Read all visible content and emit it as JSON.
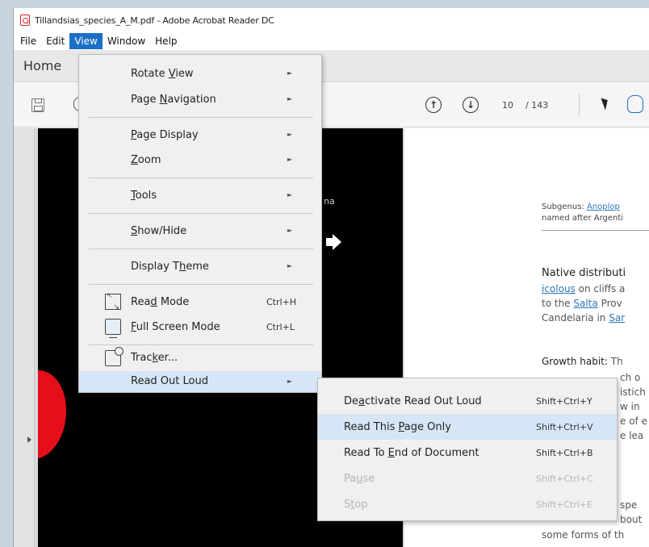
{
  "window": {
    "title": "Tillandsias_species_A_M.pdf - Adobe Acrobat Reader DC"
  },
  "menubar": {
    "items": [
      "File",
      "Edit",
      "View",
      "Window",
      "Help"
    ],
    "active": "View"
  },
  "tabbar": {
    "home_label": "Home"
  },
  "toolbar": {
    "page_current": "10",
    "page_total": "/ 143"
  },
  "page": {
    "left_fragment": "na",
    "right": {
      "subgenus_prefix": "Subgenus: ",
      "subgenus_link": "Anoplop",
      "named_after": "named after Argenti",
      "native_heading": "Native distributi",
      "line1_link": "icolous",
      "line1_rest": " on cliffs a",
      "line2_pre": "to the ",
      "line2_link": "Salta",
      "line2_rest": " Prov",
      "line3_pre": "Candelaria in ",
      "line3_link": "Sar",
      "growth_label": "Growth habit:",
      "growth_rest": " Th",
      "frag1": "ch o",
      "frag2": "istich",
      "frag3": "w in",
      "frag4": "e of e",
      "frag5": "e lea",
      "frag6": "spe",
      "frag7": "bout",
      "last_line": "some forms of th"
    }
  },
  "view_menu": {
    "items": [
      {
        "label": "Rotate View",
        "has_submenu": true
      },
      {
        "label": "Page Navigation",
        "has_submenu": true
      },
      {
        "label": "Page Display",
        "has_submenu": true
      },
      {
        "label": "Zoom",
        "has_submenu": true
      },
      {
        "label": "Tools",
        "has_submenu": true
      },
      {
        "label": "Show/Hide",
        "has_submenu": true
      },
      {
        "label": "Display Theme",
        "has_submenu": true
      },
      {
        "label": "Read Mode",
        "shortcut": "Ctrl+H",
        "icon": "read-mode-icon"
      },
      {
        "label": "Full Screen Mode",
        "shortcut": "Ctrl+L",
        "icon": "full-screen-icon"
      },
      {
        "label": "Tracker...",
        "icon": "tracker-icon"
      },
      {
        "label": "Read Out Loud",
        "has_submenu": true,
        "highlighted": true
      }
    ],
    "arrow_glyph": "►"
  },
  "read_out_loud_menu": {
    "items": [
      {
        "label": "Deactivate Read Out Loud",
        "shortcut": "Shift+Ctrl+Y",
        "enabled": true
      },
      {
        "label": "Read This Page Only",
        "shortcut": "Shift+Ctrl+V",
        "enabled": true,
        "highlighted": true
      },
      {
        "label": "Read To End of Document",
        "shortcut": "Shift+Ctrl+B",
        "enabled": true
      },
      {
        "label": "Pause",
        "shortcut": "Shift+Ctrl+C",
        "enabled": false
      },
      {
        "label": "Stop",
        "shortcut": "Shift+Ctrl+E",
        "enabled": false
      }
    ]
  },
  "colors": {
    "accent": "#1c6fc7",
    "highlight": "#d6e6f7",
    "petal": "#e50f1a"
  }
}
